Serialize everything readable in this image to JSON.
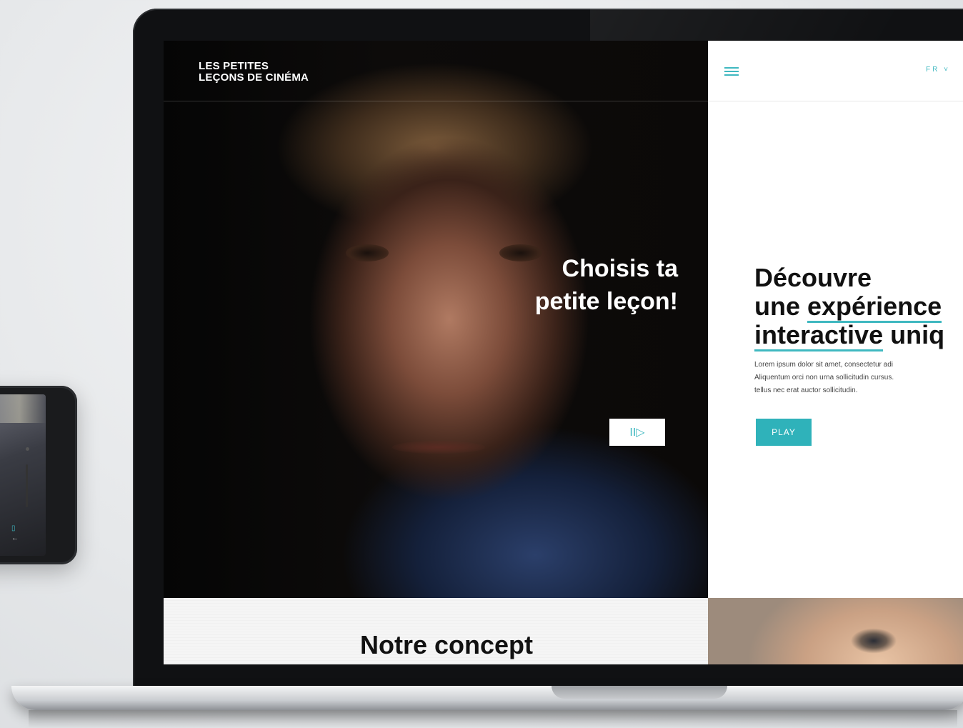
{
  "site": {
    "logo_line1": "LES PETITES",
    "logo_line2": "LEÇONS DE CINÉMA"
  },
  "hero": {
    "headline_line1": "Choisis ta",
    "headline_line2": "petite leçon!",
    "video_button_icon": "II▷"
  },
  "panel": {
    "menu_icon": "hamburger-icon",
    "language": "FR",
    "heading_line1": "Découvre",
    "heading_line2_a": "une ",
    "heading_line2_b": "expérience",
    "heading_line3_a": "interactive",
    "heading_line3_b": " uniq",
    "body_line1": "Lorem ipsum dolor sit amet, consectetur adi",
    "body_line2": "Aliquentum orci non urna sollicitudin cursus.",
    "body_line3": "tellus nec erat auctor sollicitudin.",
    "play_label": "PLAY"
  },
  "concept": {
    "title": "Notre concept"
  },
  "colors": {
    "accent": "#3fb8c0",
    "play_button": "#2fb2ba"
  }
}
